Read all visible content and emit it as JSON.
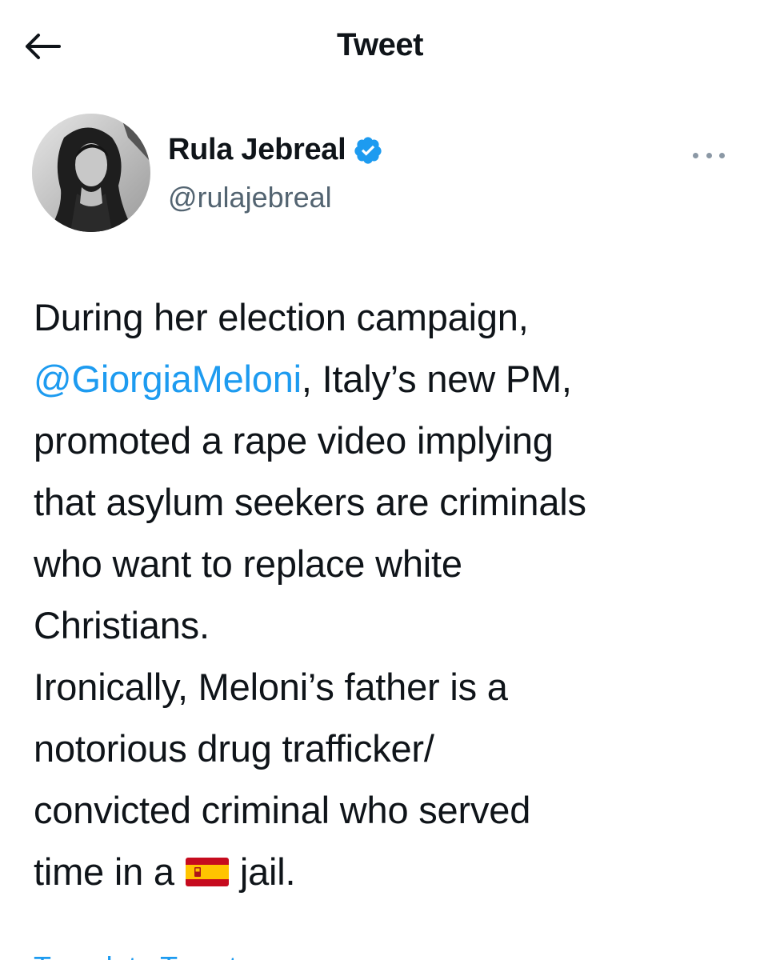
{
  "header": {
    "title": "Tweet",
    "back_icon": "arrow-left-icon"
  },
  "author": {
    "name": "Rula Jebreal",
    "handle": "@rulajebreal",
    "verified": true,
    "verified_color": "#1d9bf0"
  },
  "tweet": {
    "line1": "During her election campaign,",
    "mention": "@GiorgiaMeloni",
    "line2_rest": ", Italy’s new PM,",
    "line3": "promoted a rape video implying",
    "line4": "that asylum seekers are criminals",
    "line5": "who want to replace white",
    "line6": "Christians.",
    "line7": "Ironically, Meloni’s father is a",
    "line8": "notorious drug trafficker/",
    "line9": "convicted criminal who served",
    "line10_before": "time in a",
    "flag_icon": "spain-flag-icon",
    "line10_after": "jail."
  },
  "translate_label": "Translate Tweet",
  "colors": {
    "link": "#1d9bf0",
    "secondary_text": "#536471"
  }
}
